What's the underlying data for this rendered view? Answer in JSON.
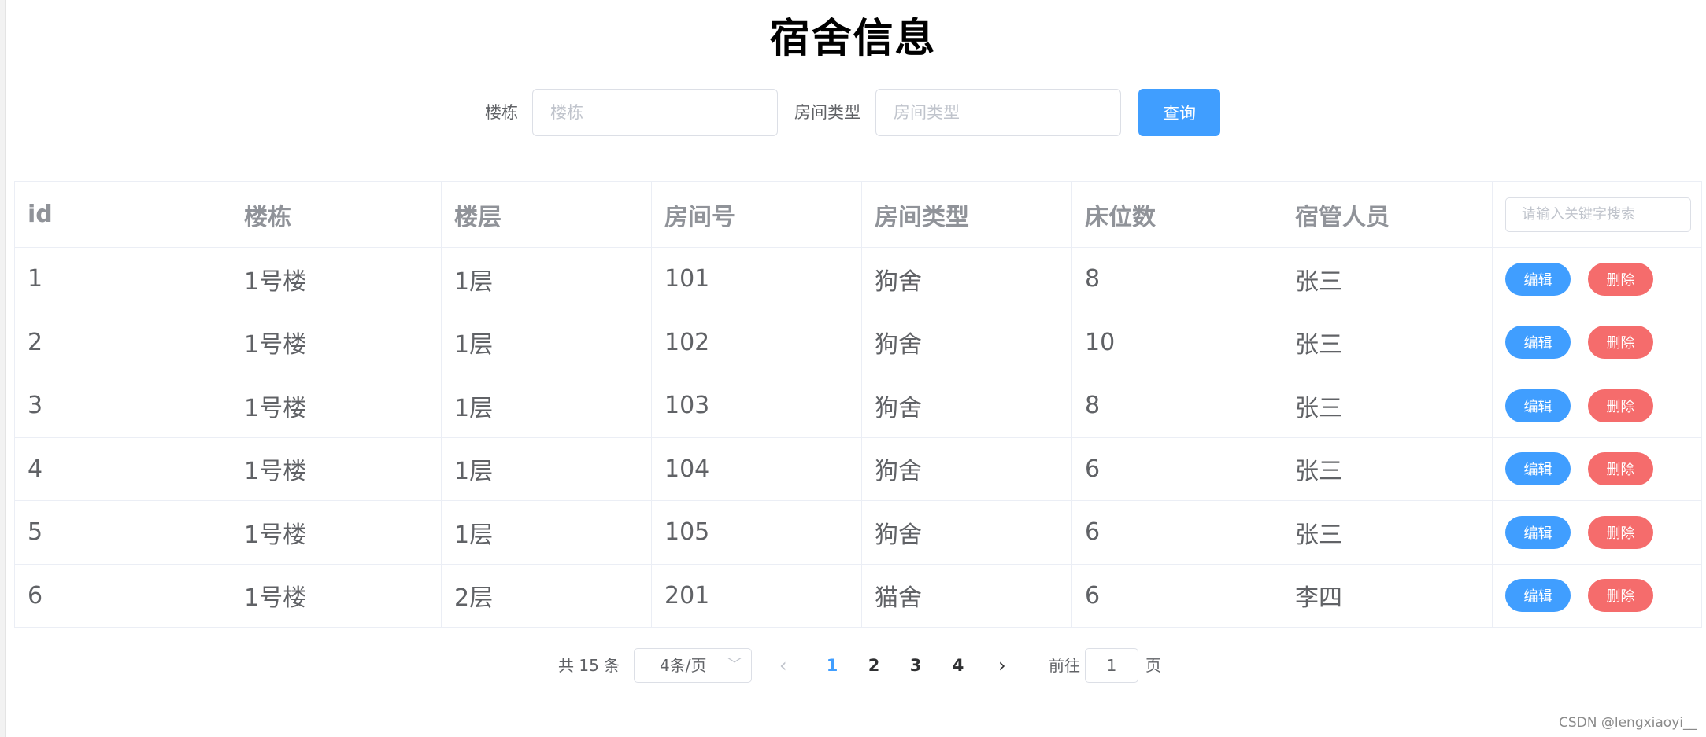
{
  "title": "宿舍信息",
  "search": {
    "building_label": "楼栋",
    "building_placeholder": "楼栋",
    "type_label": "房间类型",
    "type_placeholder": "房间类型",
    "query_button": "查询"
  },
  "table": {
    "headers": [
      "id",
      "楼栋",
      "楼层",
      "房间号",
      "房间类型",
      "床位数",
      "宿管人员"
    ],
    "keyword_placeholder": "请输入关键字搜索",
    "edit_label": "编辑",
    "delete_label": "删除",
    "rows": [
      [
        "1",
        "1号楼",
        "1层",
        "101",
        "狗舍",
        "8",
        "张三"
      ],
      [
        "2",
        "1号楼",
        "1层",
        "102",
        "狗舍",
        "10",
        "张三"
      ],
      [
        "3",
        "1号楼",
        "1层",
        "103",
        "狗舍",
        "8",
        "张三"
      ],
      [
        "4",
        "1号楼",
        "1层",
        "104",
        "狗舍",
        "6",
        "张三"
      ],
      [
        "5",
        "1号楼",
        "1层",
        "105",
        "狗舍",
        "6",
        "张三"
      ],
      [
        "6",
        "1号楼",
        "2层",
        "201",
        "猫舍",
        "6",
        "李四"
      ]
    ]
  },
  "pagination": {
    "total_text": "共 15 条",
    "page_size": "4条/页",
    "pages": [
      "1",
      "2",
      "3",
      "4"
    ],
    "current_page": "1",
    "goto_label": "前往",
    "goto_value": "1",
    "page_suffix": "页"
  },
  "watermark": "CSDN @lengxiaoyi__",
  "colors": {
    "primary": "#409eff",
    "danger": "#f56c6c",
    "header_text": "#909399",
    "body_text": "#606266"
  }
}
